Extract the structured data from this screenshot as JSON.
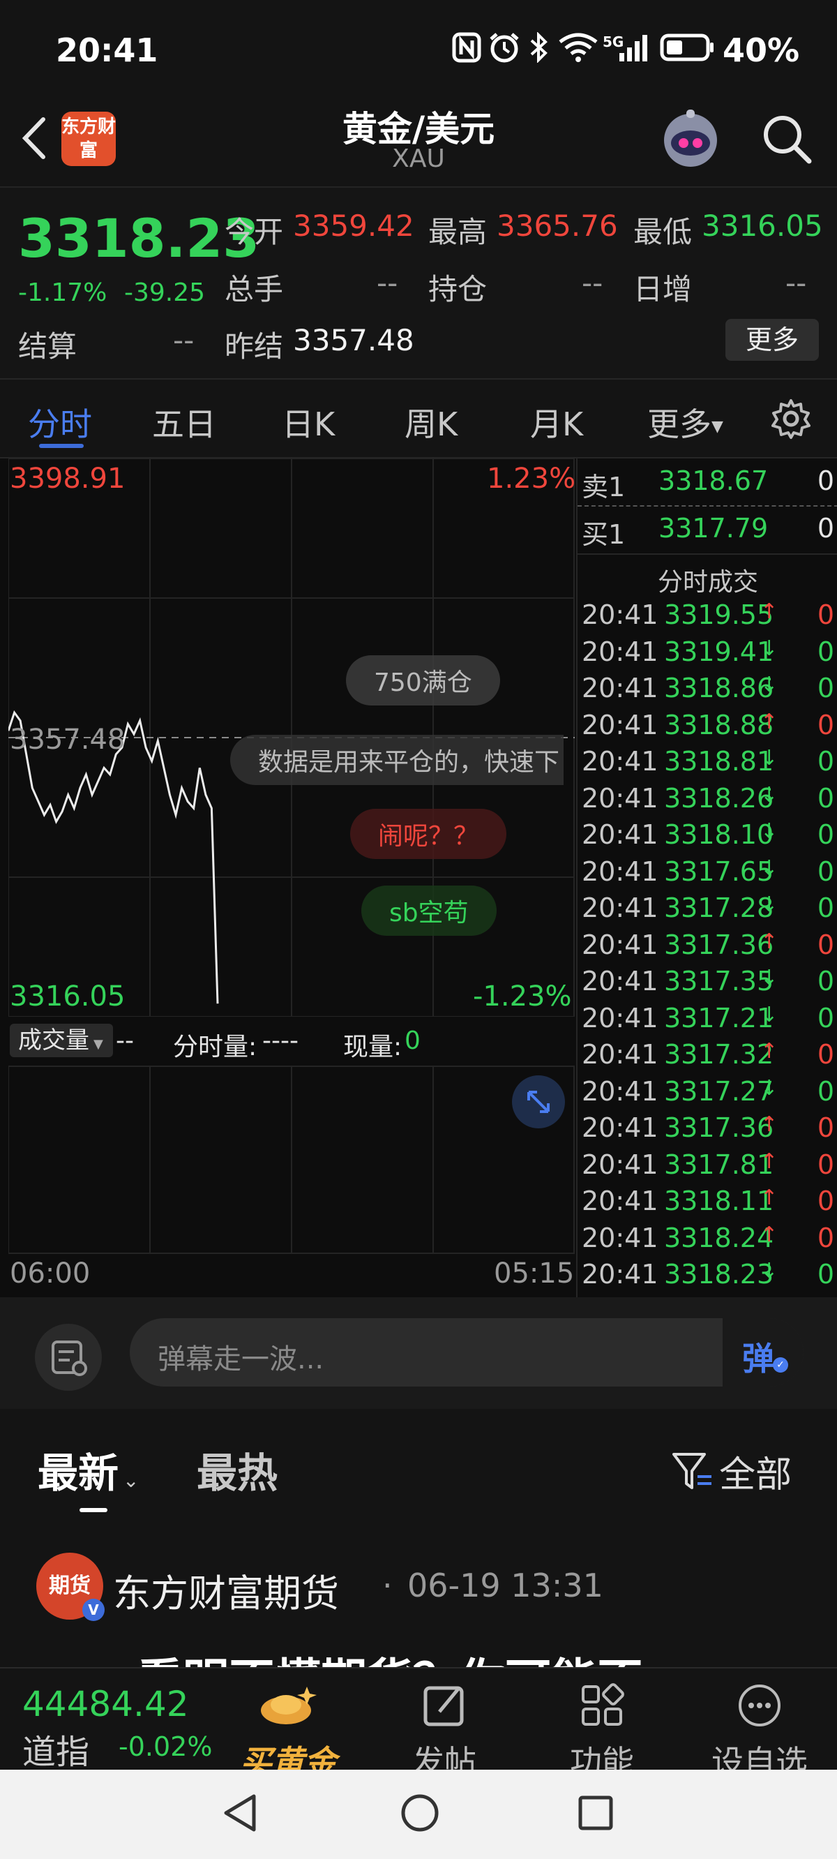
{
  "status_bar": {
    "time": "20:41",
    "icons": [
      "nfc-icon",
      "alarm-icon",
      "bluetooth-icon",
      "wifi-icon",
      "signal-5g-icon",
      "battery-icon"
    ],
    "network": "5G",
    "battery": "40%"
  },
  "header": {
    "title": "黄金/美元",
    "subtitle": "XAU",
    "logo_text": "东方财富"
  },
  "quote": {
    "price": "3318.23",
    "change_pct": "-1.17%",
    "change_abs": "-39.25",
    "settle_label": "结算",
    "settle_value": "--",
    "open_label": "今开",
    "open_value": "3359.42",
    "high_label": "最高",
    "high_value": "3365.76",
    "low_label": "最低",
    "low_value": "3316.05",
    "volume_label": "总手",
    "volume_value": "--",
    "position_label": "持仓",
    "position_value": "--",
    "daily_inc_label": "日增",
    "daily_inc_value": "--",
    "prev_settle_label": "昨结",
    "prev_settle_value": "3357.48",
    "more_label": "更多"
  },
  "tabs": [
    {
      "label": "分时",
      "active": true
    },
    {
      "label": "五日",
      "active": false
    },
    {
      "label": "日K",
      "active": false
    },
    {
      "label": "周K",
      "active": false
    },
    {
      "label": "月K",
      "active": false
    },
    {
      "label": "更多",
      "active": false
    }
  ],
  "chart": {
    "y_high": "3398.91",
    "y_high_pct": "1.23%",
    "y_low": "3316.05",
    "y_low_pct": "-1.23%",
    "y_prev": "3357.48",
    "x_start": "06:00",
    "x_end": "05:15",
    "danmaku": [
      "750满仓",
      "数据是用来平仓的，快速下",
      "闹呢？？",
      "sb空苟"
    ],
    "volume_label": "成交量",
    "volume_value": "--",
    "minute_vol_label": "分时量:",
    "minute_vol_value": "----",
    "current_vol_label": "现量:",
    "current_vol_value": "0"
  },
  "chart_data": {
    "type": "line",
    "x_range": [
      "06:00",
      "05:15"
    ],
    "ylim": [
      3316.05,
      3398.91
    ],
    "reference": 3357.48,
    "series": [
      {
        "values": [
          3358.5,
          3361.2,
          3360.0,
          3355.0,
          3350.0,
          3348.0,
          3346.0,
          3347.5,
          3345.0,
          3346.5,
          3349.0,
          3347.0,
          3350.0,
          3352.0,
          3349.0,
          3351.0,
          3353.0,
          3352.0,
          3355.0,
          3356.0,
          3359.5,
          3358.0,
          3360.0,
          3356.0,
          3354.0,
          3357.0,
          3353.0,
          3349.0,
          3346.0,
          3350.0,
          3348.0,
          3347.0,
          3353.0,
          3349.0,
          3347.0,
          3318.0
        ]
      }
    ]
  },
  "order_book": {
    "sell_label": "卖1",
    "sell_price": "3318.67",
    "sell_qty": "0",
    "buy_label": "买1",
    "buy_price": "3317.79",
    "buy_qty": "0",
    "ticks_title": "分时成交",
    "ticks": [
      {
        "time": "20:41",
        "price": "3319.55",
        "dir": "up",
        "qty": "0"
      },
      {
        "time": "20:41",
        "price": "3319.41",
        "dir": "down",
        "qty": "0"
      },
      {
        "time": "20:41",
        "price": "3318.86",
        "dir": "down",
        "qty": "0"
      },
      {
        "time": "20:41",
        "price": "3318.88",
        "dir": "up",
        "qty": "0"
      },
      {
        "time": "20:41",
        "price": "3318.81",
        "dir": "down",
        "qty": "0"
      },
      {
        "time": "20:41",
        "price": "3318.26",
        "dir": "down",
        "qty": "0"
      },
      {
        "time": "20:41",
        "price": "3318.10",
        "dir": "down",
        "qty": "0"
      },
      {
        "time": "20:41",
        "price": "3317.65",
        "dir": "down",
        "qty": "0"
      },
      {
        "time": "20:41",
        "price": "3317.28",
        "dir": "down",
        "qty": "0"
      },
      {
        "time": "20:41",
        "price": "3317.36",
        "dir": "up",
        "qty": "0"
      },
      {
        "time": "20:41",
        "price": "3317.35",
        "dir": "down",
        "qty": "0"
      },
      {
        "time": "20:41",
        "price": "3317.21",
        "dir": "down",
        "qty": "0"
      },
      {
        "time": "20:41",
        "price": "3317.32",
        "dir": "up",
        "qty": "0"
      },
      {
        "time": "20:41",
        "price": "3317.27",
        "dir": "down",
        "qty": "0"
      },
      {
        "time": "20:41",
        "price": "3317.36",
        "dir": "up",
        "qty": "0"
      },
      {
        "time": "20:41",
        "price": "3317.81",
        "dir": "up",
        "qty": "0"
      },
      {
        "time": "20:41",
        "price": "3318.11",
        "dir": "up",
        "qty": "0"
      },
      {
        "time": "20:41",
        "price": "3318.24",
        "dir": "up",
        "qty": "0"
      },
      {
        "time": "20:41",
        "price": "3318.23",
        "dir": "down",
        "qty": "0"
      }
    ]
  },
  "comment_bar": {
    "placeholder": "弹幕走一波...",
    "danmaku_button": "弹"
  },
  "feed": {
    "tab_new": "最新",
    "tab_hot": "最热",
    "filter_label": "全部",
    "post_author": "东方财富期货",
    "post_time": "06-19 13:31",
    "avatar_text": "期货",
    "post_title_partial": "看明不懂期货？你可能不"
  },
  "bottom_nav": {
    "index_value": "44484.42",
    "index_name": "道指",
    "index_change": "-0.02%",
    "items": [
      "买黄金",
      "发帖",
      "功能",
      "设自选"
    ]
  },
  "colors": {
    "up": "#f0463c",
    "down": "#35d35a",
    "accent": "#3d6cd9",
    "background": "#0d0d0d"
  }
}
